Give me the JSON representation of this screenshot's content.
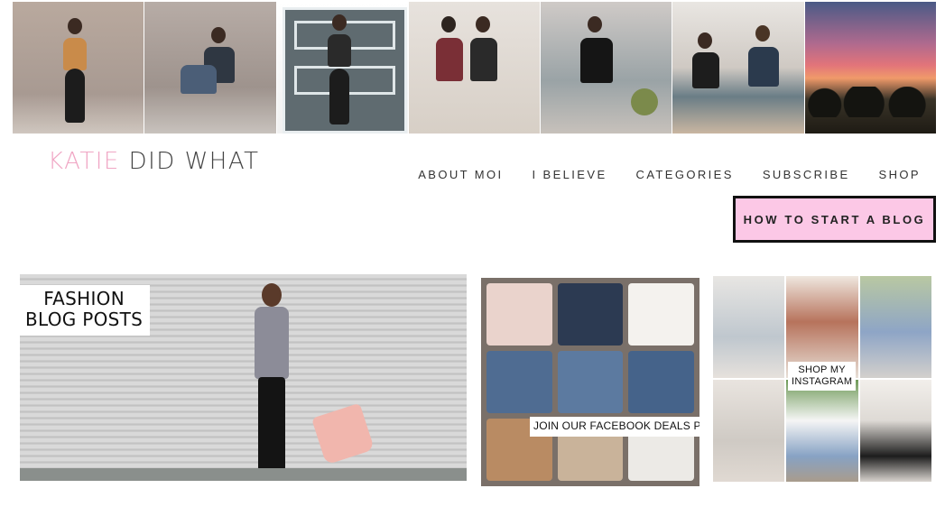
{
  "instagram_strip": {
    "tiles": [
      {
        "name": "photo-1"
      },
      {
        "name": "photo-2"
      },
      {
        "name": "photo-3"
      },
      {
        "name": "photo-4"
      },
      {
        "name": "photo-5"
      },
      {
        "name": "photo-6"
      },
      {
        "name": "photo-7"
      }
    ]
  },
  "header": {
    "logo_accent": "KATIE",
    "logo_main": "DID WHAT",
    "logo_accent_color": "#f0a6c4",
    "nav": [
      {
        "label": "ABOUT MOI"
      },
      {
        "label": "I BELIEVE"
      },
      {
        "label": "CATEGORIES"
      },
      {
        "label": "SUBSCRIBE"
      },
      {
        "label": "SHOP"
      }
    ],
    "cta_label": "HOW TO START A BLOG",
    "cta_color": "#fcc8e6"
  },
  "features": {
    "fashion": {
      "line1": "FASHION",
      "line2": "BLOG POSTS"
    },
    "facebook": {
      "label": "JOIN OUR FACEBOOK DEALS PAGE"
    },
    "instagram": {
      "line1": "SHOP MY",
      "line2": "INSTAGRAM"
    }
  }
}
